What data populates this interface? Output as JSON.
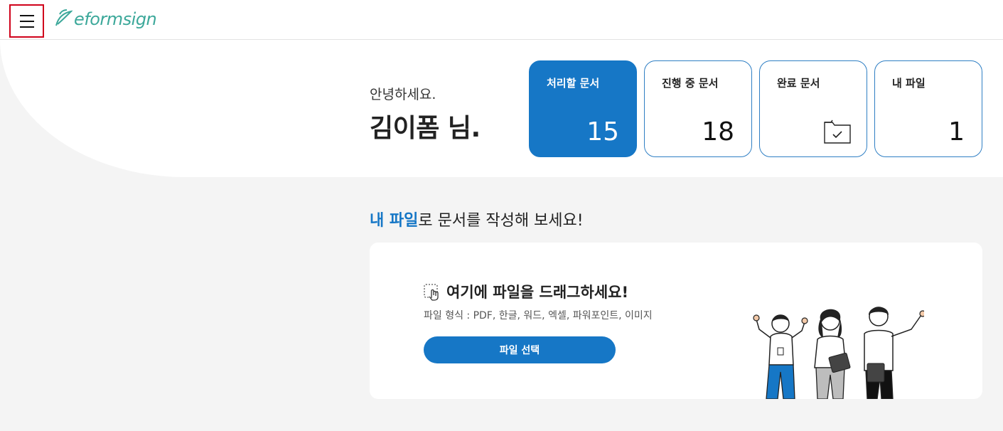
{
  "header": {
    "logo_text_e": "e",
    "logo_text_rest": "formsign"
  },
  "greeting": {
    "hello": "안녕하세요.",
    "name": "김이폼 님."
  },
  "cards": [
    {
      "title": "처리할 문서",
      "count": "15"
    },
    {
      "title": "진행 중 문서",
      "count": "18"
    },
    {
      "title": "완료 문서",
      "icon": "folder-check-icon"
    },
    {
      "title": "내 파일",
      "count": "1"
    }
  ],
  "prompt": {
    "highlight": "내 파일",
    "rest": "로 문서를 작성해 보세요!"
  },
  "upload": {
    "title": "여기에 파일을 드래그하세요!",
    "formats": "파일 형식 : PDF, 한글, 워드, 엑셀, 파워포인트, 이미지",
    "button_label": "파일 선택"
  },
  "colors": {
    "accent": "#1677c6",
    "logo": "#3ca89a",
    "highlight_border": "#d0021b"
  }
}
